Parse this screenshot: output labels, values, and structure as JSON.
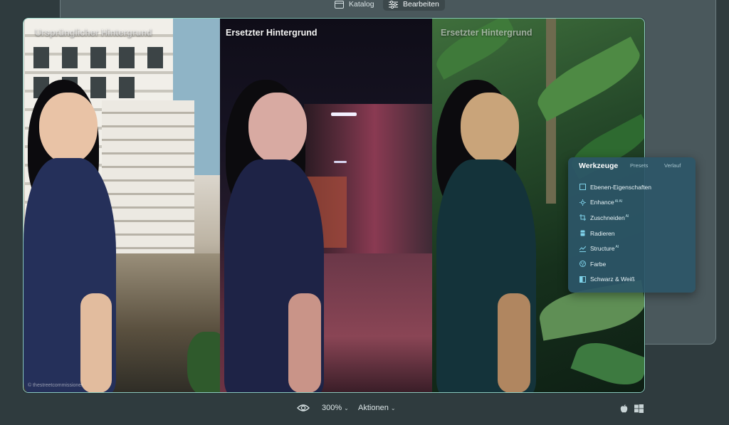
{
  "topbar": {
    "tabs": [
      {
        "label": "Katalog",
        "icon": "catalog-icon",
        "active": false
      },
      {
        "label": "Bearbeiten",
        "icon": "sliders-icon",
        "active": true
      }
    ]
  },
  "canvas": {
    "panels": [
      {
        "label": "Ursprünglicher Hintergrund"
      },
      {
        "label": "Ersetzter Hintergrund"
      },
      {
        "label": "Ersetzter Hintergrund"
      }
    ],
    "credit": "© thestreetcommissioner"
  },
  "tools_panel": {
    "tabs": [
      {
        "label": "Werkzeuge",
        "active": true
      },
      {
        "label": "Presets",
        "active": false
      },
      {
        "label": "Verlauf",
        "active": false
      }
    ],
    "items": [
      {
        "label": "Ebenen-Eigenschaften",
        "ai": "",
        "icon": "layer-properties-icon"
      },
      {
        "label": "Enhance",
        "ai": "AI AI",
        "icon": "enhance-icon"
      },
      {
        "label": "Zuschneiden",
        "ai": "AI",
        "icon": "crop-icon"
      },
      {
        "label": "Radieren",
        "ai": "",
        "icon": "eraser-icon"
      },
      {
        "label": "Structure",
        "ai": "AI",
        "icon": "structure-icon"
      },
      {
        "label": "Farbe",
        "ai": "",
        "icon": "color-icon"
      },
      {
        "label": "Schwarz & Weiß",
        "ai": "",
        "icon": "black-white-icon"
      }
    ]
  },
  "bottombar": {
    "zoom": "300%",
    "actions_label": "Aktionen",
    "icons": [
      "eye-icon",
      "apple-icon",
      "windows-icon"
    ]
  },
  "colors": {
    "accent_border": "#8fcfc4",
    "panel_bg": "#2c5668",
    "app_bg": "#2f3b3e"
  }
}
